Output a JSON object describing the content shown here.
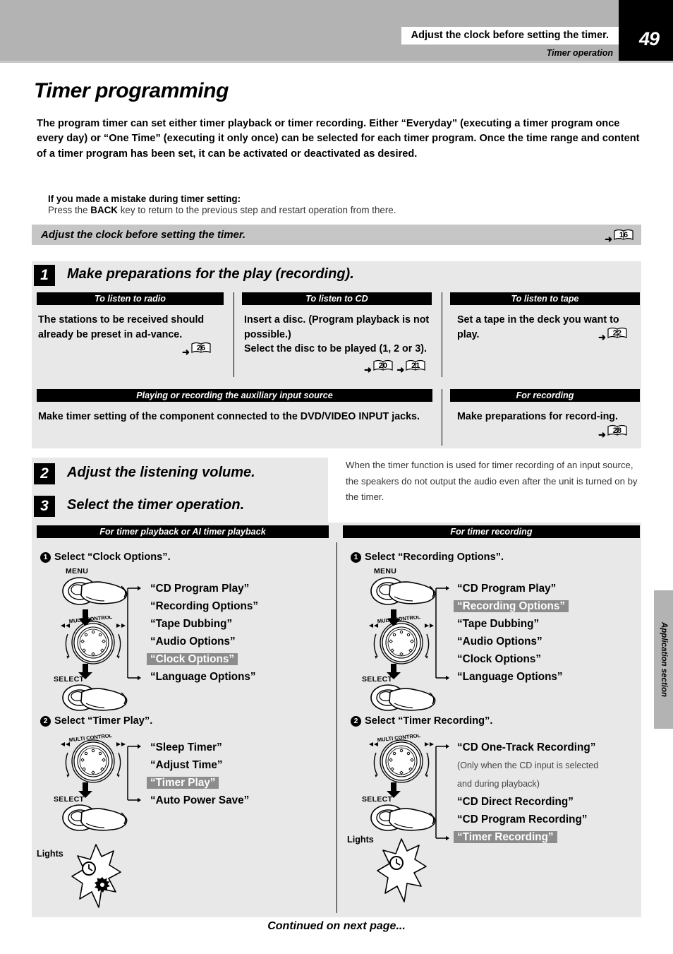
{
  "header": {
    "banner_text": "Adjust the clock before setting the timer.",
    "section_label": "Timer operation",
    "page_number": "49"
  },
  "title": "Timer programming",
  "intro": "The program timer can set either timer playback or timer recording. Either “Everyday” (executing a timer program once every day) or “One Time” (executing it only once) can be selected for each timer program. Once the time range and content of a timer program has been set, it can be activated or deactivated as desired.",
  "mistake": {
    "heading": "If you made a mistake during timer setting:",
    "before": "Press the ",
    "key": "BACK",
    "after": " key to return to the previous step and restart operation from there."
  },
  "clock_bar": {
    "text": "Adjust the clock before setting the timer.",
    "page_ref": "16"
  },
  "steps": {
    "one": {
      "num": "1",
      "title": "Make preparations for the play (recording)."
    },
    "two": {
      "num": "2",
      "title": "Adjust the listening volume."
    },
    "three": {
      "num": "3",
      "title": "Select the timer operation."
    }
  },
  "prep_boxes": [
    {
      "caption": "To listen to radio",
      "body": "The stations to be received should already be preset in ad-vance.",
      "refs": [
        "26"
      ]
    },
    {
      "caption": "To listen to CD",
      "body": "Insert a disc. (Program playback is not possible.)",
      "body2": "Select the disc to be played (1, 2 or 3).",
      "refs": [
        "20",
        "21"
      ]
    },
    {
      "caption": "To listen to tape",
      "body": "Set a tape in the deck you want to play.",
      "refs": [
        "22"
      ]
    }
  ],
  "aux_box": {
    "caption": "Playing or recording the auxiliary input source",
    "body": "Make timer setting of the component connected to the DVD/VIDEO INPUT jacks."
  },
  "rec_box": {
    "caption": "For recording",
    "body": "Make preparations for record-ing.",
    "refs": [
      "28"
    ]
  },
  "note": "When the timer function is used for timer recording of an input source, the speakers do not output the audio even after the unit is turned on by the timer.",
  "left_column": {
    "caption": "For timer playback or AI timer playback",
    "substep1": {
      "num": "1",
      "text": "Select “Clock Options”.",
      "knob_top_label": "MENU",
      "knob_mid_label": "MULTI CONTROL",
      "knob_bottom_label": "SELECT",
      "menu_items": [
        {
          "label": "“CD Program Play”",
          "highlighted": false
        },
        {
          "label": "“Recording Options”",
          "highlighted": false
        },
        {
          "label": "“Tape Dubbing”",
          "highlighted": false
        },
        {
          "label": "“Audio Options”",
          "highlighted": false
        },
        {
          "label": "“Clock Options”",
          "highlighted": true
        },
        {
          "label": "“Language Options”",
          "highlighted": false
        }
      ]
    },
    "substep2": {
      "num": "2",
      "text": "Select “Timer Play”.",
      "knob_mid_label": "MULTI CONTROL",
      "knob_bottom_label": "SELECT",
      "menu_items": [
        {
          "label": "“Sleep Timer”",
          "highlighted": false
        },
        {
          "label": "“Adjust Time”",
          "highlighted": false
        },
        {
          "label": "“Timer Play”",
          "highlighted": true
        },
        {
          "label": "“Auto Power Save”",
          "highlighted": false
        }
      ]
    },
    "lights_label": "Lights"
  },
  "right_column": {
    "caption": "For timer recording",
    "substep1": {
      "num": "1",
      "text": "Select “Recording Options”.",
      "knob_top_label": "MENU",
      "knob_mid_label": "MULTI CONTROL",
      "knob_bottom_label": "SELECT",
      "menu_items": [
        {
          "label": "“CD Program Play”",
          "highlighted": false
        },
        {
          "label": "“Recording Options”",
          "highlighted": true
        },
        {
          "label": "“Tape Dubbing”",
          "highlighted": false
        },
        {
          "label": "“Audio Options”",
          "highlighted": false
        },
        {
          "label": "“Clock Options”",
          "highlighted": false
        },
        {
          "label": "“Language Options”",
          "highlighted": false
        }
      ]
    },
    "substep2": {
      "num": "2",
      "text": "Select “Timer Recording”.",
      "knob_mid_label": "MULTI CONTROL",
      "knob_bottom_label": "SELECT",
      "menu_items": [
        {
          "label": "“CD One-Track Recording”",
          "highlighted": false
        },
        {
          "label": "(Only when the CD input is selected",
          "highlighted": false,
          "small": true
        },
        {
          "label": "and during playback)",
          "highlighted": false,
          "small": true
        },
        {
          "label": "“CD Direct Recording”",
          "highlighted": false
        },
        {
          "label": "“CD Program Recording”",
          "highlighted": false
        },
        {
          "label": "“Timer Recording”",
          "highlighted": true
        }
      ]
    },
    "lights_label": "Lights"
  },
  "side_tab": "Application section",
  "footer": "Continued on next page...",
  "colors": {
    "header_gray": "#b3b3b3",
    "panel_gray": "#e8e8e8",
    "bar_gray": "#c6c6c6",
    "highlight_gray": "#8c8c8c",
    "black": "#000000"
  }
}
